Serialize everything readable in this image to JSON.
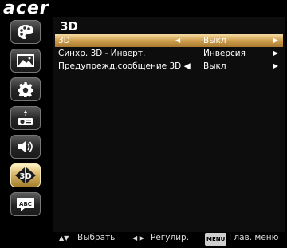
{
  "brand": "acer",
  "page_title": "3D",
  "sidebar": {
    "items": [
      {
        "name": "color-palette-icon",
        "active": false
      },
      {
        "name": "picture-icon",
        "active": false
      },
      {
        "name": "settings-gear-icon",
        "active": false
      },
      {
        "name": "projector-management-icon",
        "active": false
      },
      {
        "name": "audio-speaker-icon",
        "active": false
      },
      {
        "name": "3d-icon",
        "active": true,
        "label": "3D"
      },
      {
        "name": "language-icon",
        "active": false,
        "label": "ABC"
      }
    ]
  },
  "rows": [
    {
      "label": "3D",
      "value": "Выкл",
      "left_arrow": "◀",
      "right_arrow": "▶",
      "selected": true
    },
    {
      "label": "Синхр. 3D - Инверт.",
      "value": "Инверсия",
      "left_arrow": "",
      "right_arrow": "▶",
      "selected": false
    },
    {
      "label": "Предупрежд.сообщение 3D ◀",
      "value": "Выкл",
      "left_arrow": "",
      "right_arrow": "▶",
      "selected": false
    }
  ],
  "footer": {
    "select_icon": "▲▼",
    "select_label": "Выбрать",
    "adjust_icon": "◀ ▶",
    "adjust_label": "Регулир.",
    "menu_key": "MENU",
    "menu_label": "Глав. меню"
  },
  "colors": {
    "highlight": "#cf9f4e",
    "panel": "#0d0d0d"
  }
}
